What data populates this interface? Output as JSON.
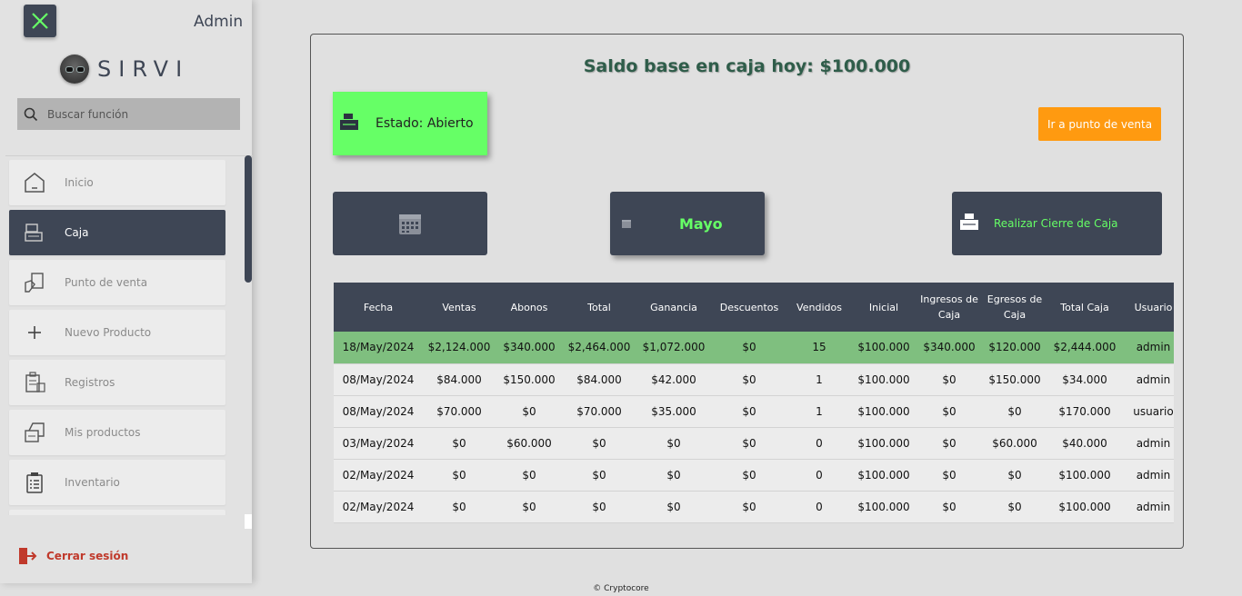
{
  "header": {
    "user_label": "Admin"
  },
  "logo": {
    "text": "SIRVI"
  },
  "search": {
    "placeholder": "Buscar función"
  },
  "sidebar": {
    "items": [
      {
        "label": "Inicio",
        "icon": "home-icon",
        "active": false
      },
      {
        "label": "Caja",
        "icon": "cash-register-icon",
        "active": true
      },
      {
        "label": "Punto de venta",
        "icon": "point-of-sale-icon",
        "active": false
      },
      {
        "label": "Nuevo Producto",
        "icon": "plus-icon",
        "active": false
      },
      {
        "label": "Registros",
        "icon": "records-icon",
        "active": false
      },
      {
        "label": "Mis productos",
        "icon": "products-icon",
        "active": false
      },
      {
        "label": "Inventario",
        "icon": "inventory-icon",
        "active": false
      }
    ],
    "logout_label": "Cerrar sesión"
  },
  "main": {
    "saldo_title": "Saldo base en caja hoy: $100.000",
    "estado_label": "Estado: Abierto",
    "punto_venta_label": "Ir a punto de venta",
    "mes_label": "Mayo",
    "cierre_label": "Realizar Cierre de Caja"
  },
  "table": {
    "headers": [
      "Fecha",
      "Ventas",
      "Abonos",
      "Total",
      "Ganancia",
      "Descuentos",
      "Vendidos",
      "Inicial",
      "Ingresos de Caja",
      "Egresos de Caja",
      "Total Caja",
      "Usuario"
    ],
    "rows": [
      [
        "18/May/2024",
        "$2,124.000",
        "$340.000",
        "$2,464.000",
        "$1,072.000",
        "$0",
        "15",
        "$100.000",
        "$340.000",
        "$120.000",
        "$2,444.000",
        "admin"
      ],
      [
        "08/May/2024",
        "$84.000",
        "$150.000",
        "$84.000",
        "$42.000",
        "$0",
        "1",
        "$100.000",
        "$0",
        "$150.000",
        "$34.000",
        "admin"
      ],
      [
        "08/May/2024",
        "$70.000",
        "$0",
        "$70.000",
        "$35.000",
        "$0",
        "1",
        "$100.000",
        "$0",
        "$0",
        "$170.000",
        "usuario"
      ],
      [
        "03/May/2024",
        "$0",
        "$60.000",
        "$0",
        "$0",
        "$0",
        "0",
        "$100.000",
        "$0",
        "$60.000",
        "$40.000",
        "admin"
      ],
      [
        "02/May/2024",
        "$0",
        "$0",
        "$0",
        "$0",
        "$0",
        "0",
        "$100.000",
        "$0",
        "$0",
        "$100.000",
        "admin"
      ],
      [
        "02/May/2024",
        "$0",
        "$0",
        "$0",
        "$0",
        "$0",
        "0",
        "$100.000",
        "$0",
        "$0",
        "$100.000",
        "admin"
      ]
    ]
  },
  "footer": {
    "text": "© Cryptocore"
  },
  "colors": {
    "dark": "#3e4655",
    "green": "#66ff66",
    "orange": "#ff9a10",
    "row_highlight": "#7fbf7f",
    "logout_red": "#c0392b"
  }
}
